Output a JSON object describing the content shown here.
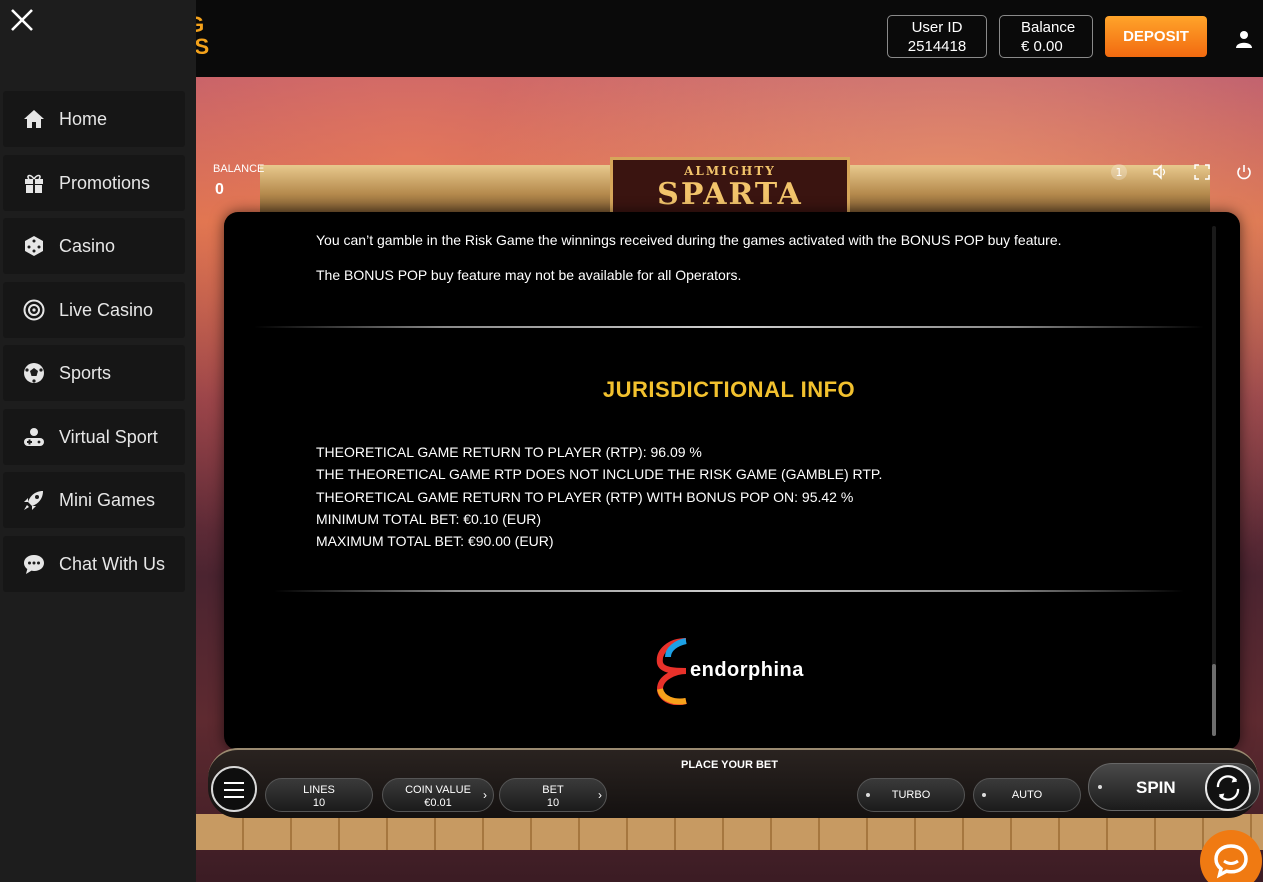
{
  "header": {
    "logo_text": "IG\nTS",
    "user_id_label": "User ID",
    "user_id_value": "2514418",
    "balance_label": "Balance",
    "balance_value": "€ 0.00",
    "deposit_label": "DEPOSIT"
  },
  "sidebar": {
    "items": [
      {
        "label": "Home",
        "icon": "home-icon"
      },
      {
        "label": "Promotions",
        "icon": "gift-icon"
      },
      {
        "label": "Casino",
        "icon": "dice-icon"
      },
      {
        "label": "Live Casino",
        "icon": "roulette-icon"
      },
      {
        "label": "Sports",
        "icon": "soccer-ball-icon"
      },
      {
        "label": "Virtual Sport",
        "icon": "gamepad-icon"
      },
      {
        "label": "Mini Games",
        "icon": "rocket-icon"
      },
      {
        "label": "Chat With Us",
        "icon": "chat-bubble-icon"
      }
    ]
  },
  "game": {
    "logo_small": "ALMIGHTY",
    "logo_big": "SPARTA",
    "balance_label": "BALANCE",
    "balance_value": "0",
    "help_badge": "1"
  },
  "paytable": {
    "line1": "You can’t gamble in the Risk Game the winnings received during the games activated with the BONUS POP buy feature.",
    "line2": "The BONUS POP buy feature may not be available for all Operators.",
    "heading": "JURISDICTIONAL INFO",
    "rtp_lines": [
      "THEORETICAL GAME RETURN TO PLAYER (RTP): 96.09 %",
      "THE THEORETICAL GAME RTP DOES NOT INCLUDE THE RISK GAME (GAMBLE) RTP.",
      "THEORETICAL GAME RETURN TO PLAYER (RTP) WITH BONUS POP ON: 95.42 %",
      "MINIMUM TOTAL BET: €0.10 (EUR)",
      "MAXIMUM TOTAL BET: €90.00 (EUR)"
    ],
    "provider": "endorphina"
  },
  "controls": {
    "place_bet": "PLACE YOUR BET",
    "lines_label": "LINES",
    "lines_value": "10",
    "coin_label": "COIN VALUE",
    "coin_value": "€0.01",
    "bet_label": "BET",
    "bet_value": "10",
    "turbo_label": "TURBO",
    "auto_label": "AUTO",
    "spin_label": "SPIN"
  },
  "colors": {
    "accent_gold": "#f2c12e",
    "deposit_orange": "#f26a10",
    "chat_orange": "#f07a12"
  }
}
